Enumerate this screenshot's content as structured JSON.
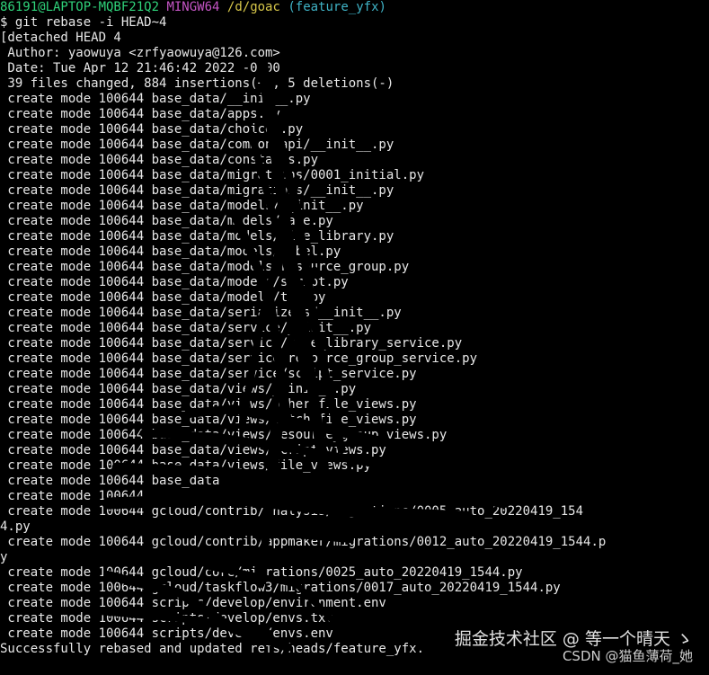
{
  "prompt": {
    "user": "86191@LAPTOP-MQBF21Q2",
    "system": "MINGW64",
    "path": "/d/goac",
    "branch": "(feature_yfx)"
  },
  "command": "$ git rebase -i HEAD~4",
  "output": [
    "[detached HEAD 4",
    " Author: yaowuya <zrfyaowuya@126.com>",
    " Date: Tue Apr 12 21:46:42 2022 -0800",
    " 39 files changed, 884 insertions(+), 5 deletions(-)",
    " create mode 100644 base_data/__init__.py",
    " create mode 100644 base_data/apps.py",
    " create mode 100644 base_data/choices.py",
    " create mode 100644 base_data/common_api/__init__.py",
    " create mode 100644 base_data/constants.py",
    " create mode 100644 base_data/migrations/0001_initial.py",
    " create mode 100644 base_data/migrations/__init__.py",
    " create mode 100644 base_data/models/__init__.py",
    " create mode 100644 base_data/models/base.py",
    " create mode 100644 base_data/models/file_library.py",
    " create mode 100644 base_data/models/label.py",
    " create mode 100644 base_data/models/resource_group.py",
    " create mode 100644 base_data/models/script.py",
    " create mode 100644 base_data/models/tag.py",
    " create mode 100644 base_data/serializers/__init__.py",
    " create mode 100644 base_data/service/__init__.py",
    " create mode 100644 base_data/service/file_library_service.py",
    " create mode 100644 base_data/service/resource_group_service.py",
    " create mode 100644 base_data/service/script_service.py",
    " create mode 100644 base_data/views/__init__.py",
    " create mode 100644 base_data/views/other_file_views.py",
    " create mode 100644 base_data/views/batch_file_views.py",
    " create mode 100644 base_data/views/resource_group_views.py",
    " create mode 100644 base_data/views/script_views.py",
    " create mode 100644 base_data/views/file_views.py",
    " create mode 100644 base_data",
    " create mode 100644",
    " create mode 100644 gcloud/contrib/analysis/migrations/0005_auto_20220419_154",
    "4.py",
    " create mode 100644 gcloud/contrib/appmaker/migrations/0012_auto_20220419_1544.p",
    "y",
    " create mode 100644 gcloud/core/migrations/0025_auto_20220419_1544.py",
    " create mode 100644 gcloud/taskflow3/migrations/0017_auto_20220419_1544.py",
    " create mode 100644 scripts/develop/environment.env",
    " create mode 100644 scripts/develop/envs.txt",
    " create mode 100644 scripts/develop/envs.env",
    "Successfully rebased and updated refs/heads/feature_yfx."
  ],
  "watermark": {
    "line1": "掘金技术社区 @ 等一个晴天 ゝ",
    "line2": "CSDN @猫鱼薄荷_她"
  },
  "colors": {
    "background": "#000000",
    "text": "#e8e8e8",
    "user_host": "#2fd27a",
    "system": "#c455c4",
    "path": "#d8c84a",
    "branch": "#3fb3c6"
  }
}
